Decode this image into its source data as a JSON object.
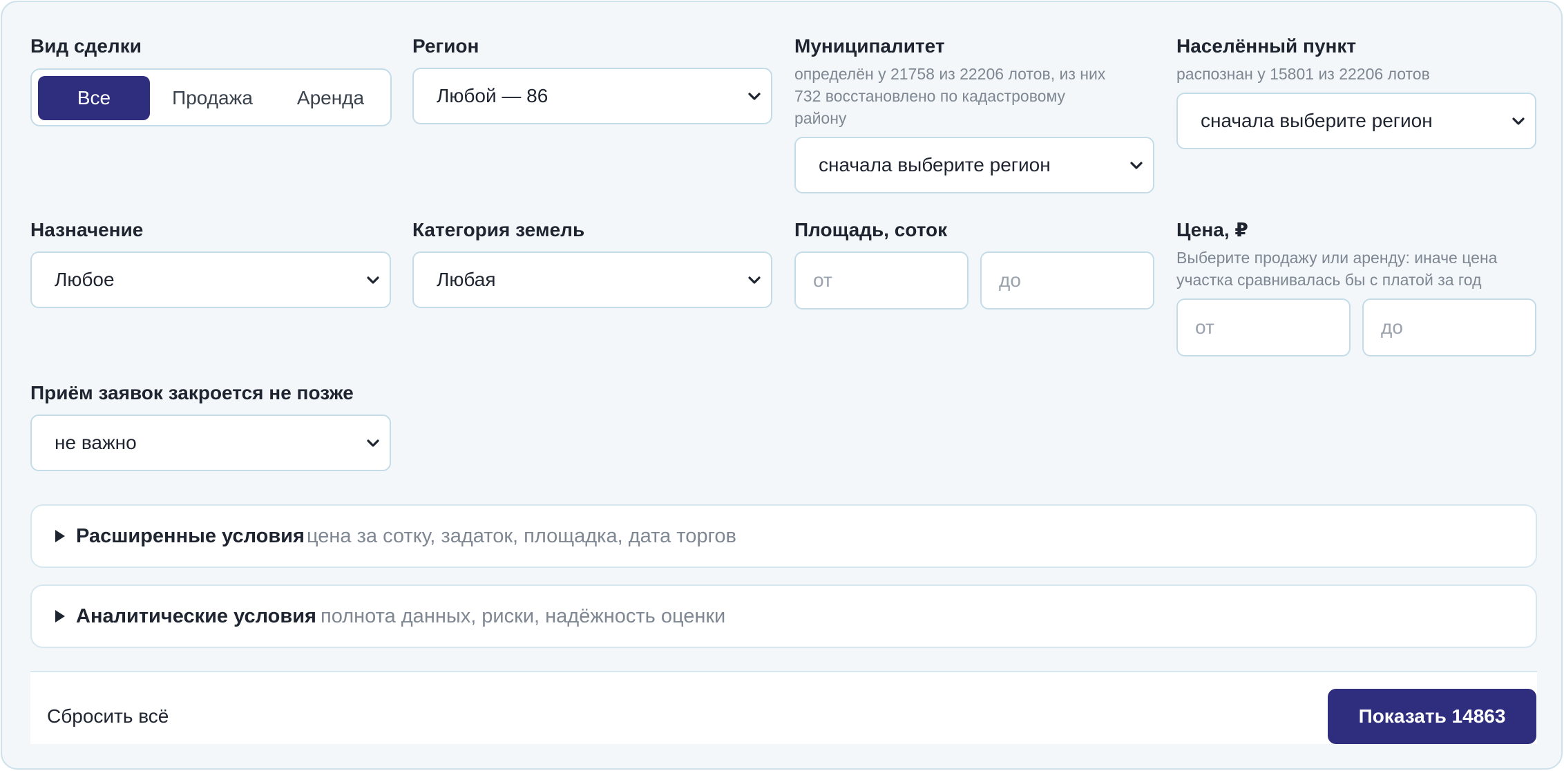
{
  "deal_type": {
    "label": "Вид сделки",
    "options": [
      "Все",
      "Продажа",
      "Аренда"
    ],
    "selected": "Все"
  },
  "region": {
    "label": "Регион",
    "value": "Любой — 86"
  },
  "municipality": {
    "label": "Муниципалитет",
    "hint_line1": "определён у 21758 из 22206 лотов, из них",
    "hint_line2": "732 восстановлено по кадастровому",
    "hint_line3": "району",
    "value": "сначала выберите регион"
  },
  "settlement": {
    "label": "Населённый пункт",
    "hint": "распознан у 15801 из 22206 лотов",
    "value": "сначала выберите регион"
  },
  "purpose": {
    "label": "Назначение",
    "value": "Любое"
  },
  "land_category": {
    "label": "Категория земель",
    "value": "Любая"
  },
  "area": {
    "label": "Площадь, соток",
    "from_placeholder": "от",
    "to_placeholder": "до"
  },
  "price": {
    "label": "Цена, ₽",
    "hint_line1": "Выберите продажу или аренду: иначе цена",
    "hint_line2": "участка сравнивалась бы с платой за год",
    "from_placeholder": "от",
    "to_placeholder": "до"
  },
  "deadline": {
    "label": "Приём заявок закроется не позже",
    "value": "не важно"
  },
  "advanced": {
    "title": "Расширенные условия",
    "subtitle": "цена за сотку, задаток, площадка, дата торгов"
  },
  "analytics": {
    "title": "Аналитические условия",
    "subtitle": "полнота данных, риски, надёжность оценки"
  },
  "footer": {
    "reset_label": "Сбросить всё",
    "show_label": "Показать 14863"
  },
  "colors": {
    "accent": "#2e2d7e",
    "panel_bg": "#f3f7fa",
    "border": "#c3dce8"
  }
}
